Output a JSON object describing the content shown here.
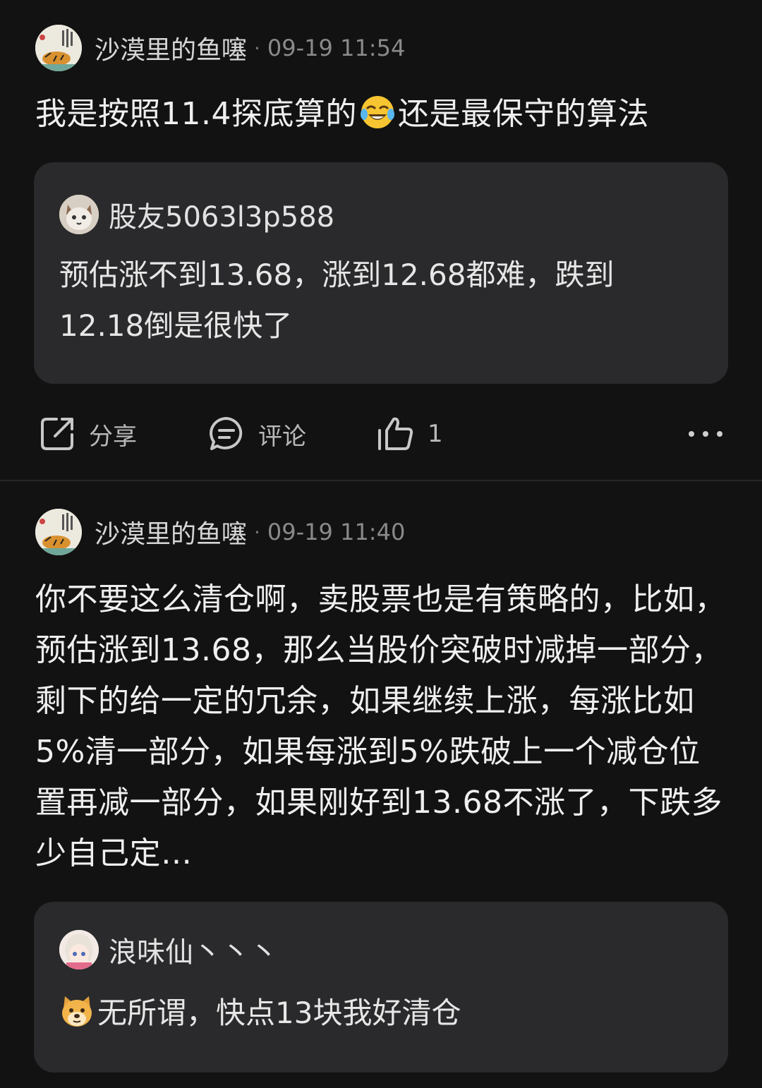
{
  "posts": [
    {
      "author": "沙漠里的鱼噻",
      "separator": "·",
      "time": "09-19 11:54",
      "text_before_emoji": "我是按照11.4探底算的",
      "text_after_emoji": "还是最保守的算法",
      "emoji_icon": "laughing-crying-emoji",
      "quote": {
        "author": "股友5063l3p588",
        "text": "预估涨不到13.68，涨到12.68都难，跌到12.18倒是很快了"
      },
      "actions": {
        "share_label": "分享",
        "comment_label": "评论",
        "like_count": "1"
      }
    },
    {
      "author": "沙漠里的鱼噻",
      "separator": "·",
      "time": "09-19 11:40",
      "text": "你不要这么清仓啊，卖股票也是有策略的，比如，预估涨到13.68，那么当股价突破时减掉一部分，剩下的给一定的冗余，如果继续上涨，每涨比如5%清一部分，如果每涨到5%跌破上一个减仓位置再减一部分，如果刚好到13.68不涨了，下跌多少自己定…",
      "quote": {
        "author": "浪味仙丶丶丶",
        "emoji_icon": "doge-emoji",
        "text": "无所谓，快点13块我好清仓"
      }
    }
  ],
  "colors": {
    "background": "#121212",
    "card": "#2A2A2C",
    "text_primary": "#EFEFEF",
    "text_secondary": "#8A8A8A"
  }
}
